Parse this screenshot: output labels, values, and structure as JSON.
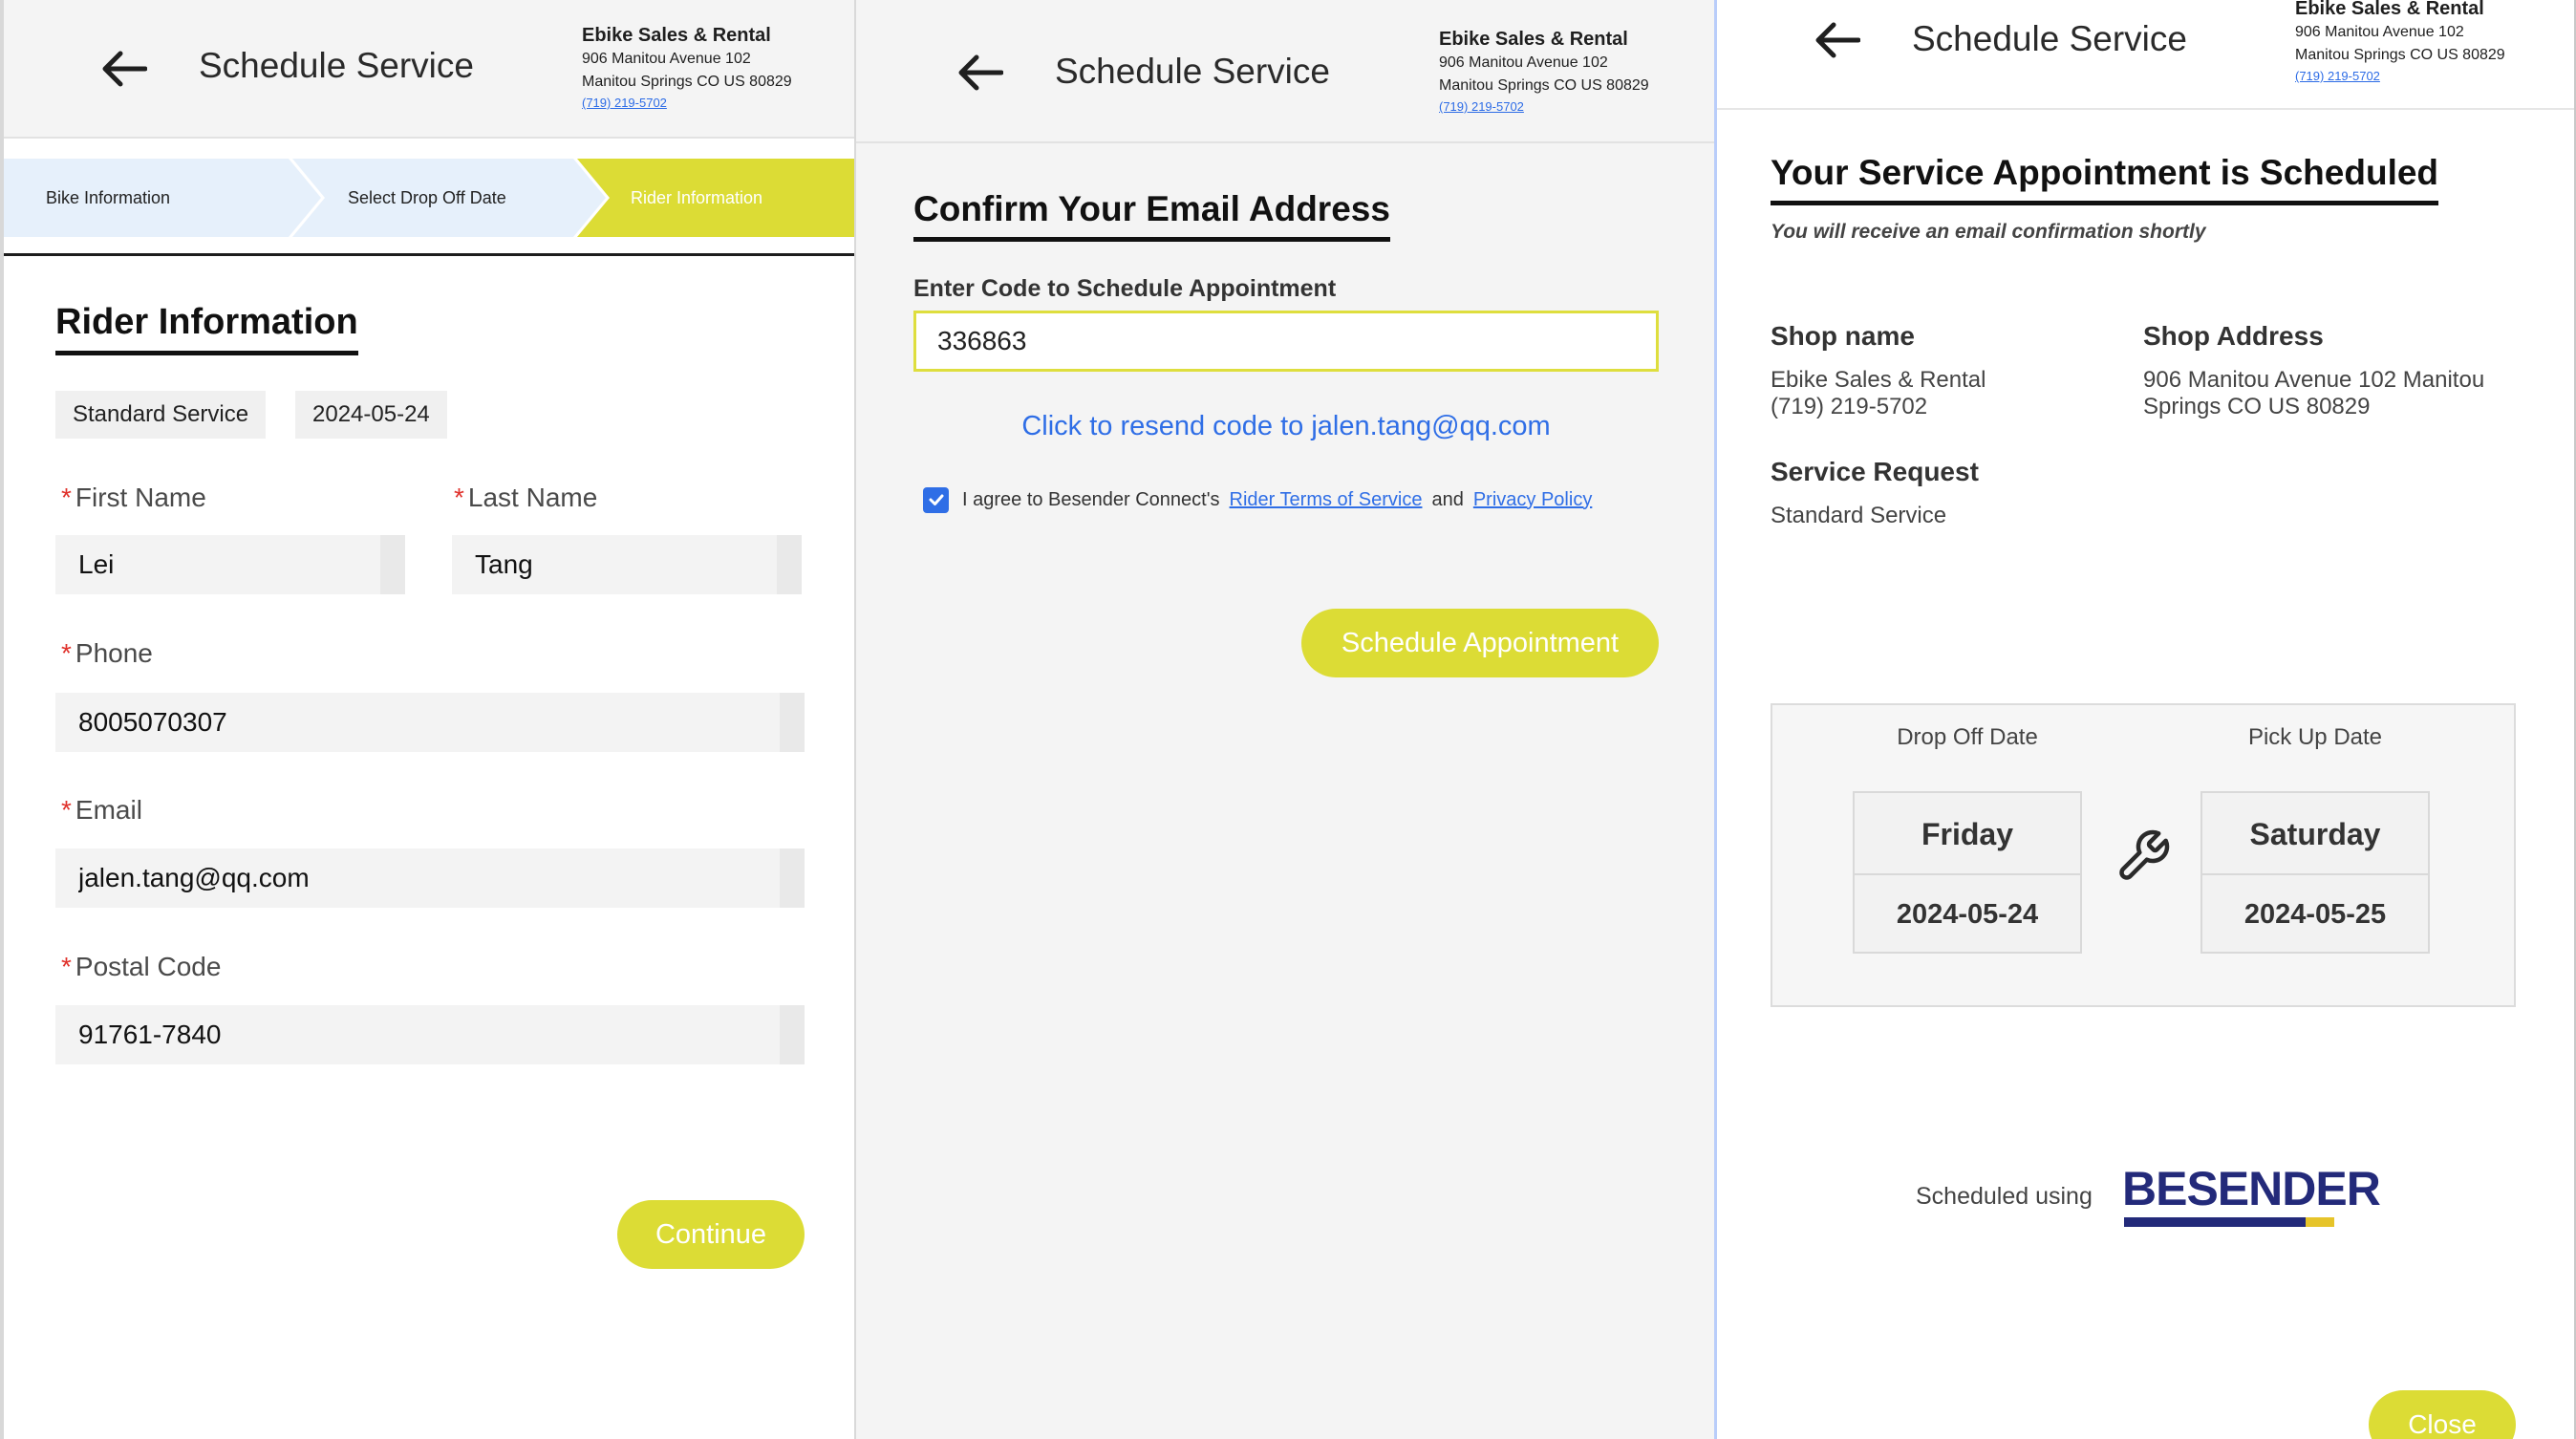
{
  "header": {
    "title": "Schedule Service",
    "shop_name": "Ebike Sales & Rental",
    "address_line1": "906 Manitou Avenue 102",
    "address_line2": "Manitou Springs CO US 80829",
    "phone": "(719) 219-5702"
  },
  "rider_panel": {
    "steps": [
      {
        "label": "Bike Information"
      },
      {
        "label": "Select Drop Off Date"
      },
      {
        "label": "Rider Information"
      }
    ],
    "section_title": "Rider Information",
    "chips": [
      "Standard Service",
      "2024-05-24"
    ],
    "fields": {
      "first_name": {
        "label": "First Name",
        "value": "Lei"
      },
      "last_name": {
        "label": "Last Name",
        "value": "Tang"
      },
      "phone": {
        "label": "Phone",
        "value": "8005070307"
      },
      "email": {
        "label": "Email",
        "value": "jalen.tang@qq.com"
      },
      "postal": {
        "label": "Postal Code",
        "value": "91761-7840"
      }
    },
    "required_mark": "*",
    "continue_label": "Continue"
  },
  "confirm_panel": {
    "title": "Confirm Your Email Address",
    "code_label": "Enter Code to Schedule Appointment",
    "code_value": "336863",
    "resend_text": "Click to resend code to jalen.tang@qq.com",
    "agree_prefix": "I agree to Besender Connect's",
    "terms_link": "Rider Terms of Service",
    "and_text": "and",
    "privacy_link": "Privacy Policy",
    "agreed": true,
    "schedule_label": "Schedule Appointment"
  },
  "scheduled_panel": {
    "title": "Your Service Appointment is Scheduled",
    "subtitle": "You will receive an email confirmation shortly",
    "shop_name_heading": "Shop name",
    "shop_name_value": "Ebike Sales & Rental",
    "shop_phone_value": "(719) 219-5702",
    "shop_address_heading": "Shop Address",
    "shop_address_value": "906 Manitou Avenue 102 Manitou Springs CO US 80829",
    "service_request_heading": "Service Request",
    "service_request_value": "Standard Service",
    "drop_off_label": "Drop Off Date",
    "drop_off_day": "Friday",
    "drop_off_date": "2024-05-24",
    "pick_up_label": "Pick Up Date",
    "pick_up_day": "Saturday",
    "pick_up_date": "2024-05-25",
    "scheduled_using": "Scheduled using",
    "brand": "BESENDER",
    "close_label": "Close"
  },
  "colors": {
    "accent_yellow": "#dcdc35",
    "step_inactive": "#e6f0fb",
    "link_blue": "#2f6ee6",
    "brand_navy": "#232a7a",
    "required_red": "#e0322c"
  },
  "icons": [
    "back-arrow-icon",
    "checkbox-checked-icon",
    "wrench-icon"
  ]
}
